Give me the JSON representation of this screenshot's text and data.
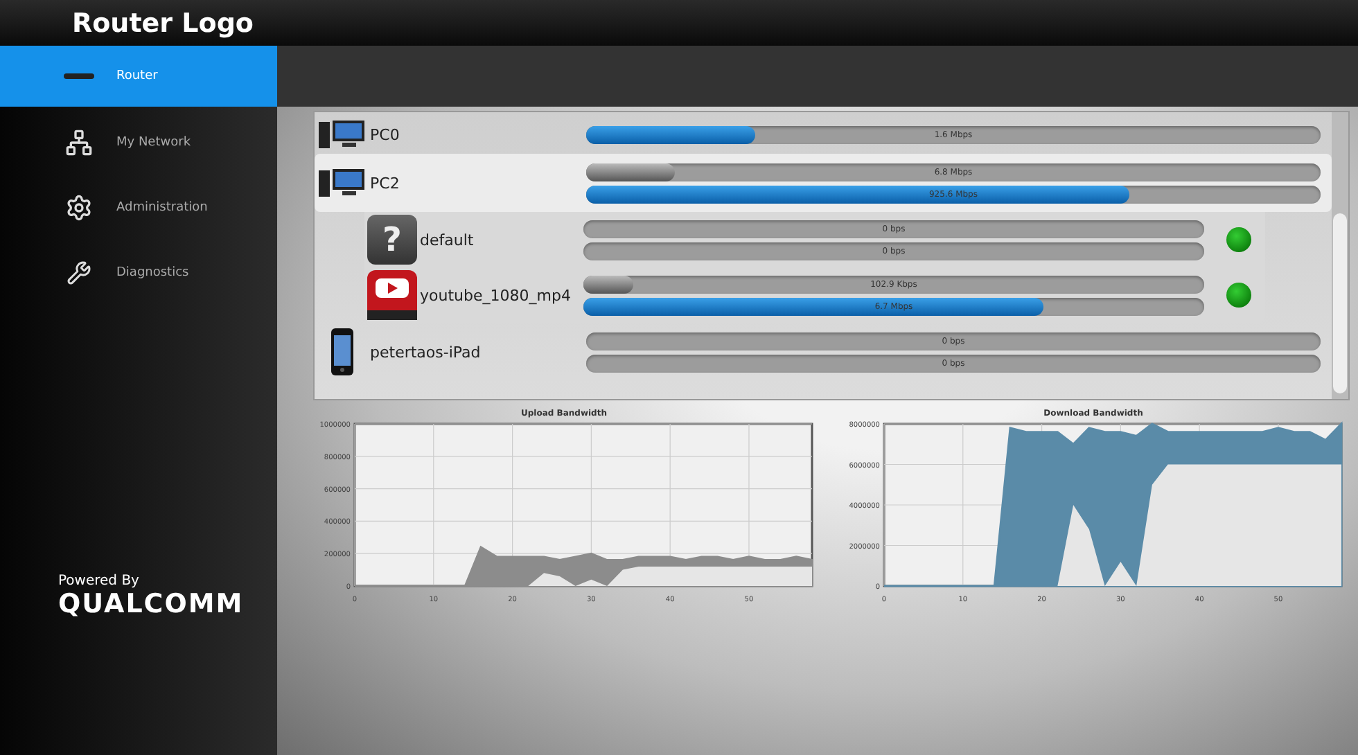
{
  "header": {
    "logo": "Router Logo"
  },
  "sidebar": {
    "items": [
      {
        "label": "Router",
        "kind": "router",
        "selected": true
      },
      {
        "label": "My Network",
        "kind": "network",
        "selected": false
      },
      {
        "label": "Administration",
        "kind": "gear",
        "selected": false
      },
      {
        "label": "Diagnostics",
        "kind": "tools",
        "selected": false
      }
    ],
    "powered_by": "Powered By",
    "brand": "QUALCOMM"
  },
  "devices": [
    {
      "name": "PC0",
      "kind": "desktop",
      "selected": false,
      "bars": [
        {
          "kind": "download",
          "level": 0.23,
          "reading": "1.6 Mbps"
        }
      ]
    },
    {
      "name": "PC2",
      "kind": "desktop",
      "selected": true,
      "bars": [
        {
          "kind": "upload",
          "level": 0.12,
          "reading": "6.8 Mbps"
        },
        {
          "kind": "download",
          "level": 0.74,
          "reading": "925.6 Mbps"
        }
      ],
      "children": [
        {
          "name": "default",
          "kind": "unknown",
          "icon_glyph": "?",
          "online": true,
          "bars": [
            {
              "kind": "upload",
              "level": 0,
              "reading": "0 bps"
            },
            {
              "kind": "download",
              "level": 0,
              "reading": "0 bps"
            }
          ]
        },
        {
          "name": "youtube_1080_mp4",
          "kind": "video",
          "online": true,
          "bars": [
            {
              "kind": "upload",
              "level": 0.08,
              "reading": "102.9 Kbps"
            },
            {
              "kind": "download",
              "level": 0.74,
              "reading": "6.7 Mbps"
            }
          ]
        }
      ]
    },
    {
      "name": "petertaos-iPad",
      "kind": "tablet",
      "selected": false,
      "bars": [
        {
          "kind": "upload",
          "level": 0,
          "reading": "0 bps"
        },
        {
          "kind": "download",
          "level": 0,
          "reading": "0 bps"
        }
      ]
    }
  ],
  "charts": [
    {
      "chart_data": {
        "type": "area",
        "title": "Upload Bandwidth",
        "grid": true,
        "x": [
          0,
          2,
          4,
          6,
          8,
          10,
          12,
          14,
          16,
          18,
          20,
          22,
          24,
          26,
          28,
          30,
          32,
          34,
          36,
          38,
          40,
          42,
          44,
          46,
          48,
          50,
          52,
          54,
          56,
          58
        ],
        "series": [
          {
            "color": "#8c8c8c",
            "values": [
              0,
              0,
              0,
              0,
              0,
              0,
              0,
              0,
              240000,
              180000,
              180000,
              180000,
              180000,
              160000,
              180000,
              200000,
              160000,
              160000,
              180000,
              180000,
              180000,
              160000,
              180000,
              180000,
              160000,
              180000,
              160000,
              160000,
              180000,
              160000
            ]
          },
          {
            "color": "#e6e6e6",
            "values": [
              0,
              0,
              0,
              0,
              0,
              0,
              0,
              0,
              0,
              0,
              0,
              0,
              80000,
              60000,
              0,
              40000,
              0,
              100000,
              120000,
              120000,
              120000,
              120000,
              120000,
              120000,
              120000,
              120000,
              120000,
              120000,
              120000,
              120000
            ]
          }
        ],
        "xlim": [
          0,
          58
        ],
        "ylim": [
          0,
          1000000
        ],
        "xticks": [
          0,
          10,
          20,
          30,
          40,
          50
        ],
        "yticks": [
          0,
          200000,
          400000,
          600000,
          800000,
          1000000
        ]
      }
    },
    {
      "chart_data": {
        "type": "area",
        "title": "Download Bandwidth",
        "grid": true,
        "x": [
          0,
          2,
          4,
          6,
          8,
          10,
          12,
          14,
          16,
          18,
          20,
          22,
          24,
          26,
          28,
          30,
          32,
          34,
          36,
          38,
          40,
          42,
          44,
          46,
          48,
          50,
          52,
          54,
          56,
          58
        ],
        "series": [
          {
            "color": "#5a8ba8",
            "values": [
              0,
              0,
              0,
              0,
              0,
              0,
              0,
              0,
              7800000,
              7600000,
              7600000,
              7600000,
              7000000,
              7800000,
              7600000,
              7600000,
              7400000,
              8000000,
              7600000,
              7600000,
              7600000,
              7600000,
              7600000,
              7600000,
              7600000,
              7800000,
              7600000,
              7600000,
              7200000,
              8000000
            ]
          },
          {
            "color": "#e6e6e6",
            "values": [
              0,
              0,
              0,
              0,
              0,
              0,
              0,
              0,
              0,
              0,
              0,
              0,
              4000000,
              2800000,
              0,
              1200000,
              0,
              5000000,
              6000000,
              6000000,
              6000000,
              6000000,
              6000000,
              6000000,
              6000000,
              6000000,
              6000000,
              6000000,
              6000000,
              6000000
            ]
          }
        ],
        "xlim": [
          0,
          58
        ],
        "ylim": [
          0,
          8000000
        ],
        "xticks": [
          0,
          10,
          20,
          30,
          40,
          50
        ],
        "yticks": [
          0,
          2000000,
          4000000,
          6000000,
          8000000
        ]
      }
    }
  ]
}
